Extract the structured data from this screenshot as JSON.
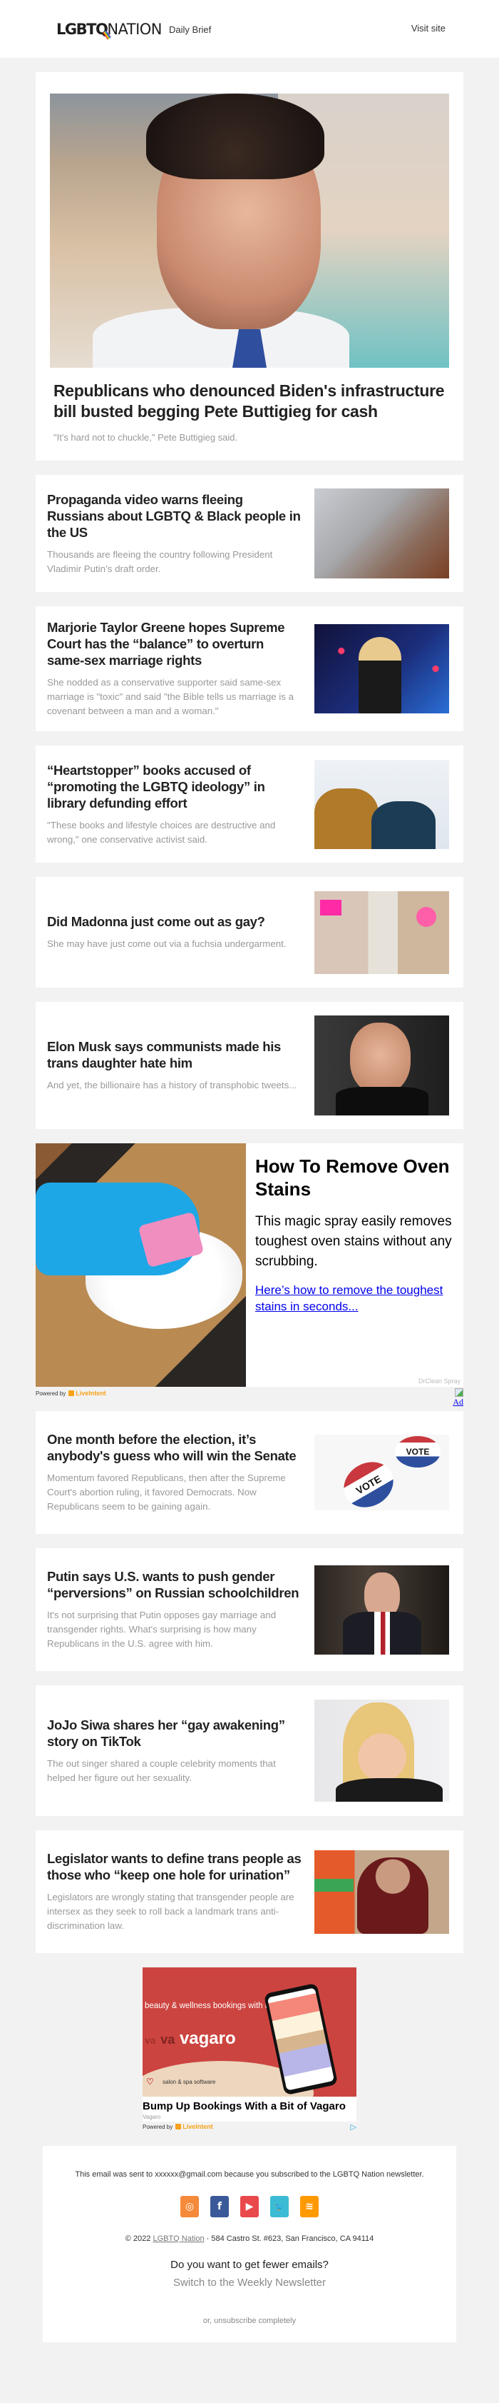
{
  "header": {
    "logo_bold": "LGBT",
    "logo_q": "Q",
    "logo_thin": "NATION",
    "tagline": "Daily Brief",
    "visit_site": "Visit site"
  },
  "hero": {
    "image_alt": "Pete Buttigieg smiling",
    "title": "Republicans who denounced Biden's infrastructure bill busted begging Pete Buttigieg for cash",
    "subtitle": "\"It's hard not to chuckle,\" Pete Buttigieg said."
  },
  "stories_top": [
    {
      "title": "Propaganda video warns fleeing Russians about LGBTQ & Black people in the US",
      "desc": "Thousands are fleeing the country following President Vladimir Putin’s draft order.",
      "thumb": "plane"
    },
    {
      "title": "Marjorie Taylor Greene hopes Supreme Court has the “balance” to overturn same-sex marriage rights",
      "desc": "She nodded as a conservative supporter said same-sex marriage is \"toxic\" and said \"the Bible tells us marriage is a covenant between a man and a woman.\"",
      "thumb": "mtg"
    },
    {
      "title": "“Heartstopper” books accused of “promoting the LGBTQ ideology” in library defunding effort",
      "desc": "\"These books and lifestyle choices are destructive and wrong,\" one conservative activist said.",
      "thumb": "heart"
    },
    {
      "title": "Did Madonna just come out as gay?",
      "desc": "She may have just come out via a fuchsia undergarment.",
      "thumb": "madonna"
    },
    {
      "title": "Elon Musk says communists made his trans daughter hate him",
      "desc": "And yet, the billionaire has a history of transphobic tweets...",
      "thumb": "musk"
    }
  ],
  "ad_oven": {
    "headline": "How To Remove Oven Stains",
    "body": "This magic spray easily removes toughest oven stains without any scrubbing.",
    "link": "Here’s how to remove the toughest stains in seconds...",
    "brand": "DrClean Spray",
    "powered_by": "Powered by",
    "powered_brand": "LiveIntent",
    "ad_label": "Ad"
  },
  "stories_bottom": [
    {
      "title": "One month before the election, it’s anybody's guess who will win the Senate",
      "desc": "Momentum favored Republicans, then after the Supreme Court's abortion ruling, it favored Democrats. Now Republicans seem to be gaining again.",
      "thumb": "vote"
    },
    {
      "title": "Putin says U.S. wants to push gender “perversions” on Russian schoolchildren",
      "desc": "It's not surprising that Putin opposes gay marriage and transgender rights. What's surprising is how many Republicans in the U.S. agree with him.",
      "thumb": "putin"
    },
    {
      "title": "JoJo Siwa shares her “gay awakening” story on TikTok",
      "desc": "The out singer shared a couple celebrity moments that helped her figure out her sexuality.",
      "thumb": "jojo"
    },
    {
      "title": "Legislator wants to define trans people as those who “keep one hole for urination”",
      "desc": "Legislators are wrongly stating that transgender people are intersex as they seek to roll back a landmark trans anti-discrimination law.",
      "thumb": "legis"
    }
  ],
  "ad_vagaro": {
    "image_line1": "beauty & wellness bookings with more",
    "image_va1": "va",
    "image_va2": "va",
    "image_brand": "vagaro",
    "image_tagline": "salon & spa software",
    "headline": "Bump Up Bookings With a Bit of Vagaro",
    "brand": "Vagaro",
    "powered_by": "Powered by",
    "powered_brand": "LiveIntent"
  },
  "footer": {
    "sent_notice": "This email was sent to xxxxxx@gmail.com because you subscribed to the LGBTQ Nation newsletter.",
    "socials": [
      {
        "name": "instagram",
        "glyph": "◎",
        "color": "#f58a3b"
      },
      {
        "name": "facebook",
        "glyph": "f",
        "color": "#3b5998"
      },
      {
        "name": "youtube",
        "glyph": "▶",
        "color": "#e9494b"
      },
      {
        "name": "twitter",
        "glyph": "🐦",
        "color": "#3cbcd4"
      },
      {
        "name": "rss",
        "glyph": "≋",
        "color": "#ff9900"
      }
    ],
    "copyright": "© 2022",
    "site_link": "LGBTQ Nation",
    "address": "· 584 Castro St. #623, San Francisco, CA 94114",
    "fewer_question": "Do you want to get fewer emails?",
    "switch_link": "Switch to the Weekly Newsletter",
    "unsubscribe": "or, unsubscribe completely"
  }
}
